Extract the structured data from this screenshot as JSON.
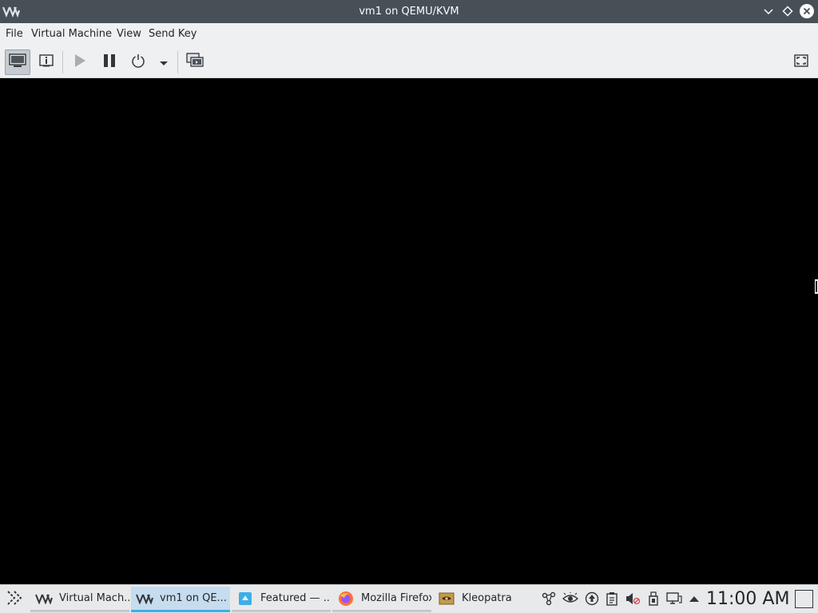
{
  "window": {
    "title": "vm1 on QEMU/KVM",
    "app_icon": "virt-manager-icon"
  },
  "menubar": {
    "items": [
      "File",
      "Virtual Machine",
      "View",
      "Send Key"
    ]
  },
  "toolbar": {
    "buttons": [
      {
        "name": "console-view",
        "icon": "monitor-icon",
        "active": true
      },
      {
        "name": "details-view",
        "icon": "info-icon",
        "active": false
      },
      {
        "name": "run",
        "icon": "play-icon",
        "enabled": false
      },
      {
        "name": "pause",
        "icon": "pause-icon",
        "enabled": true
      },
      {
        "name": "shutdown",
        "icon": "power-icon",
        "enabled": true
      },
      {
        "name": "shutdown-menu",
        "icon": "chevron-down-icon",
        "enabled": true
      },
      {
        "name": "snapshots",
        "icon": "snapshots-icon",
        "enabled": true
      },
      {
        "name": "fullscreen",
        "icon": "fullscreen-icon",
        "enabled": true
      }
    ]
  },
  "display": {
    "background": "#000000"
  },
  "taskbar": {
    "tasks": [
      {
        "label": "Virtual Mach...",
        "icon": "virt-manager-icon",
        "active": false
      },
      {
        "label": "vm1 on QE...",
        "icon": "virt-manager-icon",
        "active": true
      },
      {
        "label": "Featured — ...",
        "icon": "discover-icon",
        "active": false
      },
      {
        "label": "Mozilla Firefox",
        "icon": "firefox-icon",
        "active": false
      },
      {
        "label": "Kleopatra",
        "icon": "kleopatra-icon",
        "active": false
      }
    ],
    "tray_icons": [
      "network-share-icon",
      "eye-icon",
      "update-icon",
      "clipboard-icon",
      "volume-muted-icon",
      "usb-device-icon",
      "display-icon",
      "expand-tray-icon"
    ],
    "clock": "11:00 AM"
  },
  "colors": {
    "titlebar": "#475057",
    "accent": "#3daee9",
    "active_task": "#c6dcef"
  }
}
